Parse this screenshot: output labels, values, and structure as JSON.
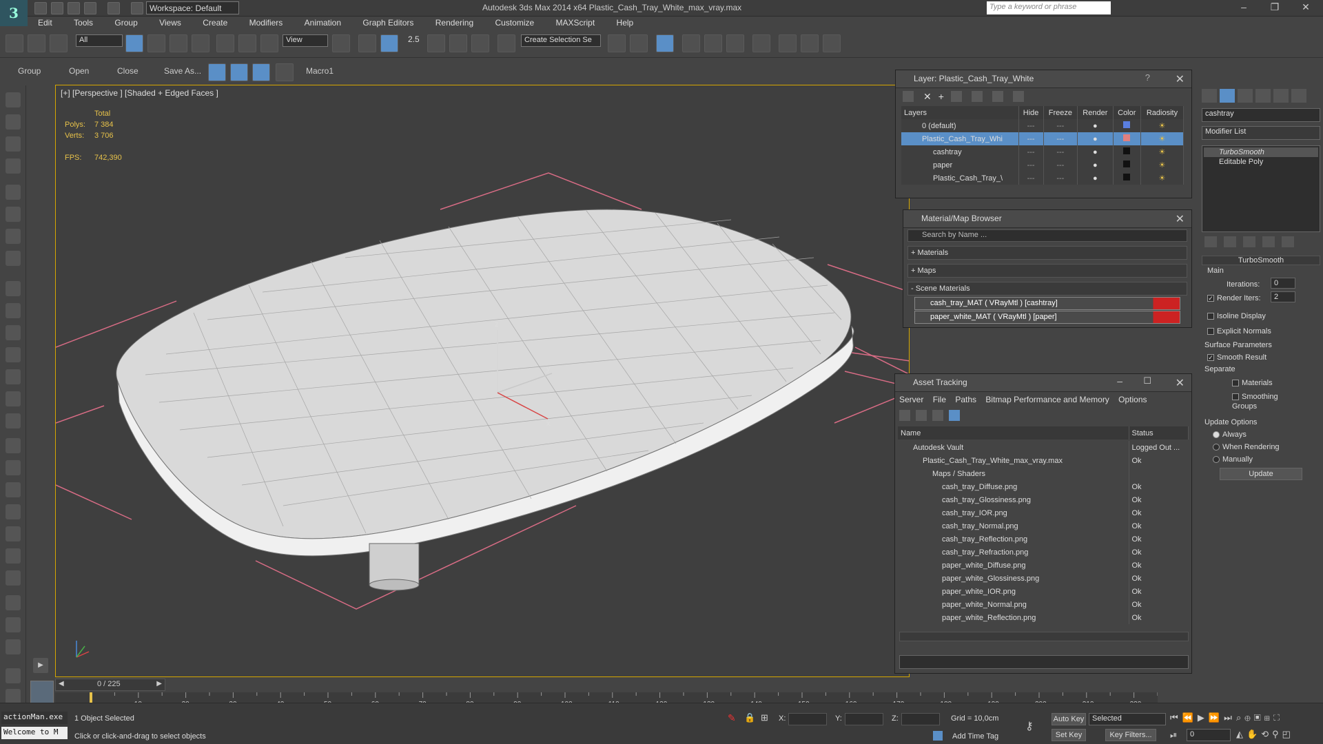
{
  "app": {
    "title": "Autodesk 3ds Max  2014 x64     Plastic_Cash_Tray_White_max_vray.max",
    "workspace": "Workspace: Default",
    "search_placeholder": "Type a keyword or phrase",
    "logo": "3"
  },
  "menu": [
    "Edit",
    "Tools",
    "Group",
    "Views",
    "Create",
    "Modifiers",
    "Animation",
    "Graph Editors",
    "Rendering",
    "Customize",
    "MAXScript",
    "Help"
  ],
  "toolbar": {
    "selection_filter": "All",
    "ref_coord": "View",
    "snap_label": "2.5",
    "named_selection": "Create Selection Se"
  },
  "ribbon": {
    "items": [
      "Group",
      "Open",
      "Close",
      "Save As...",
      "Macro1"
    ]
  },
  "viewport": {
    "label": "[+] [Perspective ] [Shaded + Edged Faces ]",
    "stats": {
      "total_label": "Total",
      "polys_label": "Polys:",
      "polys": "7 384",
      "verts_label": "Verts:",
      "verts": "3 706",
      "fps_label": "FPS:",
      "fps": "742,390"
    },
    "gizmo": {
      "x": "x",
      "y": "y",
      "z": "z"
    }
  },
  "layer_panel": {
    "title": "Layer: Plastic_Cash_Tray_White",
    "columns": [
      "Layers",
      "Hide",
      "Freeze",
      "Render",
      "Color",
      "Radiosity"
    ],
    "rows": [
      {
        "name": "0 (default)",
        "color": "#5a7fe0"
      },
      {
        "name": "Plastic_Cash_Tray_Whi",
        "color": "#e07f7f"
      },
      {
        "name": "cashtray",
        "color": "#111111"
      },
      {
        "name": "paper",
        "color": "#111111"
      },
      {
        "name": "Plastic_Cash_Tray_\\",
        "color": "#111111"
      }
    ]
  },
  "material_browser": {
    "title": "Material/Map Browser",
    "search_placeholder": "Search by Name ...",
    "sections": [
      "+ Materials",
      "+ Maps",
      "- Scene Materials"
    ],
    "items": [
      "cash_tray_MAT ( VRayMtl ) [cashtray]",
      "paper_white_MAT ( VRayMtl ) [paper]"
    ]
  },
  "asset_tracking": {
    "title": "Asset Tracking",
    "menu": [
      "Server",
      "File",
      "Paths",
      "Bitmap Performance and Memory",
      "Options"
    ],
    "columns": [
      "Name",
      "Status"
    ],
    "rows": [
      {
        "name": "Autodesk Vault",
        "status": "Logged Out ...",
        "indent": 1
      },
      {
        "name": "Plastic_Cash_Tray_White_max_vray.max",
        "status": "Ok",
        "indent": 2
      },
      {
        "name": "Maps / Shaders",
        "status": "",
        "indent": 3
      },
      {
        "name": "cash_tray_Diffuse.png",
        "status": "Ok",
        "indent": 4
      },
      {
        "name": "cash_tray_Glossiness.png",
        "status": "Ok",
        "indent": 4
      },
      {
        "name": "cash_tray_IOR.png",
        "status": "Ok",
        "indent": 4
      },
      {
        "name": "cash_tray_Normal.png",
        "status": "Ok",
        "indent": 4
      },
      {
        "name": "cash_tray_Reflection.png",
        "status": "Ok",
        "indent": 4
      },
      {
        "name": "cash_tray_Refraction.png",
        "status": "Ok",
        "indent": 4
      },
      {
        "name": "paper_white_Diffuse.png",
        "status": "Ok",
        "indent": 4
      },
      {
        "name": "paper_white_Glossiness.png",
        "status": "Ok",
        "indent": 4
      },
      {
        "name": "paper_white_IOR.png",
        "status": "Ok",
        "indent": 4
      },
      {
        "name": "paper_white_Normal.png",
        "status": "Ok",
        "indent": 4
      },
      {
        "name": "paper_white_Reflection.png",
        "status": "Ok",
        "indent": 4
      }
    ]
  },
  "command_panel": {
    "object_name": "cashtray",
    "modifier_list": "Modifier List",
    "stack": [
      "TurboSmooth",
      "Editable Poly"
    ],
    "turbosmooth": {
      "title": "TurboSmooth",
      "main": "Main",
      "iterations_label": "Iterations:",
      "iterations": "0",
      "render_iters_label": "Render Iters:",
      "render_iters": "2",
      "isoline": "Isoline Display",
      "explicit_normals": "Explicit Normals",
      "surface_params": "Surface Parameters",
      "smooth_result": "Smooth Result",
      "separate": "Separate",
      "materials": "Materials",
      "smoothing_groups": "Smoothing Groups",
      "update_options": "Update Options",
      "always": "Always",
      "when_rendering": "When Rendering",
      "manually": "Manually",
      "update": "Update"
    }
  },
  "timeline": {
    "frame": "0 / 225",
    "ticks": [
      "10",
      "20",
      "30",
      "40",
      "50",
      "60",
      "70",
      "80",
      "90",
      "100",
      "110",
      "120",
      "130",
      "140",
      "150",
      "160",
      "170",
      "180",
      "190",
      "200",
      "210",
      "220"
    ]
  },
  "status": {
    "maxscript_1": "actionMan.exe",
    "maxscript_2": "Welcome to M",
    "selected": "1 Object Selected",
    "prompt": "Click or click-and-drag to select objects",
    "x_label": "X:",
    "y_label": "Y:",
    "z_label": "Z:",
    "grid": "Grid = 10,0cm",
    "add_time_tag": "Add Time Tag",
    "auto_key": "Auto Key",
    "set_key": "Set Key",
    "key_mode": "Selected",
    "key_filters": "Key Filters...",
    "current_frame": "0"
  }
}
